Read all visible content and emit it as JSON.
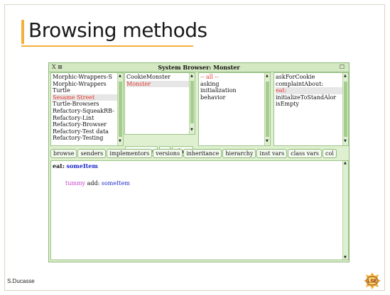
{
  "slide": {
    "title": "Browsing methods",
    "author": "S.Ducasse",
    "logo_text": "LSE"
  },
  "window": {
    "title": "System Browser: Monster",
    "close_glyph": "X",
    "menu_glyph": "⊞",
    "expand_glyph": "☐"
  },
  "categories": {
    "items": [
      {
        "label": "Morphic-Wrappers-S",
        "state": "normal"
      },
      {
        "label": "Morphic-Wrappers",
        "state": "normal"
      },
      {
        "label": "Turtle",
        "state": "normal"
      },
      {
        "label": "Sesame Street",
        "state": "selected"
      },
      {
        "label": "Turtle-Browsers",
        "state": "normal"
      },
      {
        "label": "Refactory-SqueakRB-",
        "state": "normal"
      },
      {
        "label": "Refactory-Lint",
        "state": "normal"
      },
      {
        "label": "Refactory-Browser",
        "state": "normal"
      },
      {
        "label": "Refactory-Test data",
        "state": "normal"
      },
      {
        "label": "Refactory-Testing",
        "state": "normal"
      }
    ]
  },
  "classes": {
    "items": [
      {
        "label": "CookieMonster",
        "state": "normal"
      },
      {
        "label": "Monster",
        "state": "selected"
      }
    ],
    "buttons": [
      "instance",
      "?",
      "class"
    ]
  },
  "protocols": {
    "items": [
      {
        "label": "-- all --",
        "state": "red"
      },
      {
        "label": "asking",
        "state": "normal"
      },
      {
        "label": "initialization",
        "state": "normal"
      },
      {
        "label": "behavior",
        "state": "normal"
      }
    ]
  },
  "methods": {
    "items": [
      {
        "label": "askForCookie",
        "state": "normal"
      },
      {
        "label": "complaintAbout:",
        "state": "normal"
      },
      {
        "label": "eat:",
        "state": "selected"
      },
      {
        "label": "initializeToStandAlor",
        "state": "normal"
      },
      {
        "label": "isEmpty",
        "state": "normal"
      }
    ]
  },
  "toolbar": [
    "browse",
    "senders",
    "implementors",
    "versions",
    "inheritance",
    "hierarchy",
    "inst vars",
    "class vars",
    "col"
  ],
  "code": {
    "selector": "eat:",
    "arg": "someItem",
    "receiver": "tummy",
    "message": "add:",
    "msg_arg": "someItem"
  }
}
